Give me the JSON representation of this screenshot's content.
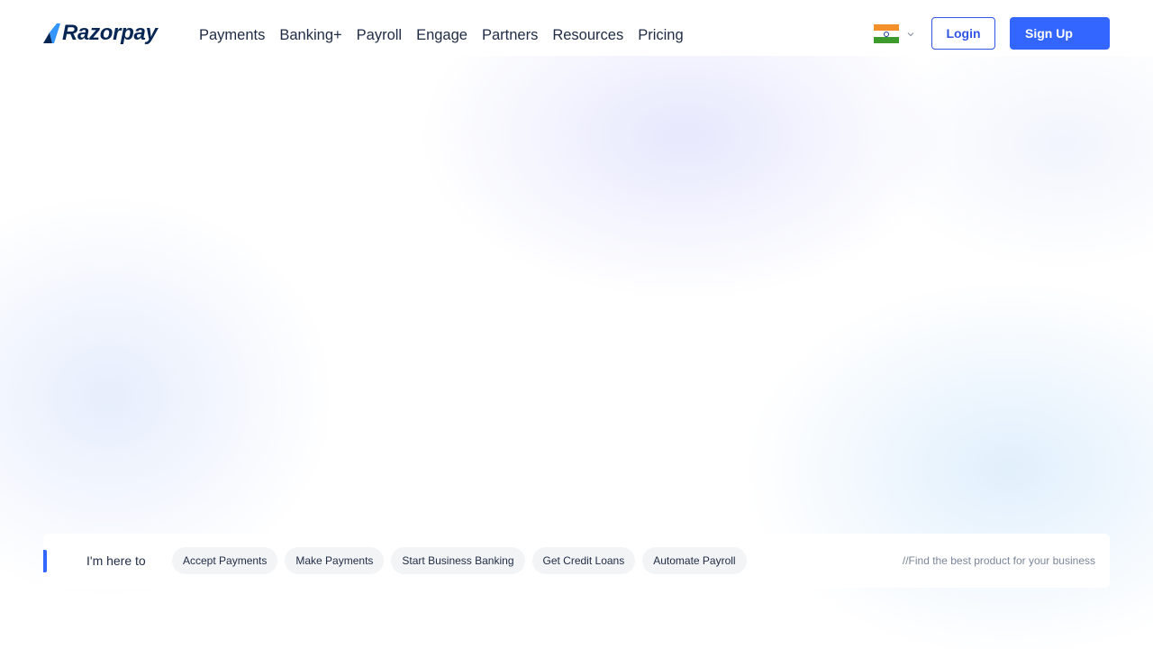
{
  "header": {
    "logo_text": "Razorpay",
    "nav": [
      "Payments",
      "Banking+",
      "Payroll",
      "Engage",
      "Partners",
      "Resources",
      "Pricing"
    ],
    "country_flag_icon": "india-flag-icon",
    "login_label": "Login",
    "signup_label": "Sign Up"
  },
  "here_bar": {
    "label": "I'm here to",
    "chips": [
      "Accept Payments",
      "Make Payments",
      "Start Business Banking",
      "Get Credit Loans",
      "Automate Payroll"
    ],
    "hint": "//Find the best product for your business"
  },
  "colors": {
    "brand_blue": "#3366ff",
    "logo_navy": "#072654",
    "text_dark": "#1f2a44",
    "hint_gray": "#7a8699",
    "chip_bg": "#f2f4f6"
  }
}
